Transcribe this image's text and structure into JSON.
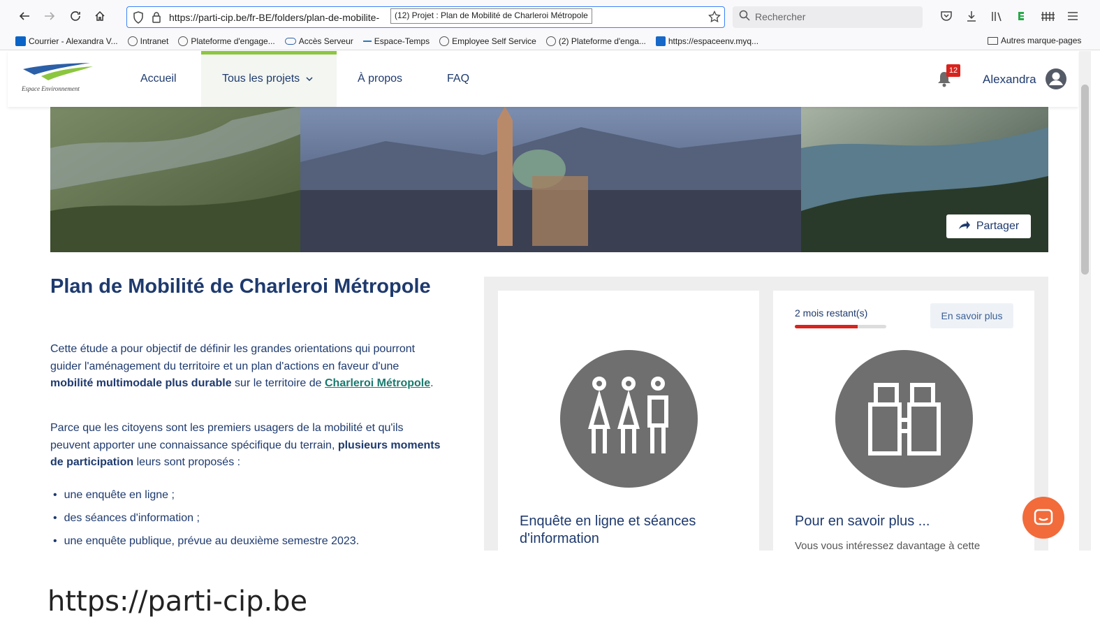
{
  "browser": {
    "url": "https://parti-cip.be/fr-BE/folders/plan-de-mobilite-",
    "tab_tooltip": "(12) Projet : Plan de Mobilité de Charleroi Métropole",
    "search_placeholder": "Rechercher",
    "bookmarks": [
      {
        "label": "Courrier - Alexandra V..."
      },
      {
        "label": "Intranet"
      },
      {
        "label": "Plateforme d'engage..."
      },
      {
        "label": "Accès Serveur"
      },
      {
        "label": "Espace-Temps"
      },
      {
        "label": "Employee Self Service"
      },
      {
        "label": "(2) Plateforme d'enga..."
      },
      {
        "label": "https://espaceenv.myq..."
      }
    ],
    "other_bookmarks": "Autres marque-pages"
  },
  "site": {
    "logo_text": "Espace Environnement",
    "nav": {
      "home": "Accueil",
      "projects": "Tous les projets",
      "about": "À propos",
      "faq": "FAQ"
    },
    "notifications_count": "12",
    "user_name": "Alexandra",
    "share_label": "Partager"
  },
  "project": {
    "title": "Plan de Mobilité de Charleroi Métropole",
    "p1_a": "Cette étude a pour objectif de définir les grandes orientations qui pourront guider l'aménagement du territoire et un plan d'actions en faveur d'une ",
    "p1_b": "mobilité multimodale plus durable",
    "p1_c": " sur le territoire de ",
    "p1_link": "Charleroi Métropole",
    "p1_d": ".",
    "p2_a": "Parce que les citoyens sont les premiers usagers de la mobilité et qu'ils peuvent apporter une connaissance spécifique du terrain, ",
    "p2_b": "plusieurs moments de participation",
    "p2_c": " leurs sont proposés :",
    "list": [
      "une enquête en ligne ;",
      "des séances d'information ;",
      "une enquête publique, prévue au deuxième semestre 2023."
    ]
  },
  "cards": [
    {
      "title": "Enquête en ligne et séances d'information",
      "icon": "people-icon"
    },
    {
      "title": "Pour en savoir plus ...",
      "subtitle": "Vous vous intéressez davantage à cette",
      "icon": "binoculars-icon",
      "remaining": "2 mois restant(s)",
      "progress": 0.69,
      "more_label": "En savoir plus"
    }
  ],
  "caption": "https://parti-cip.be",
  "colors": {
    "primary": "#1e3a6e",
    "accent_green": "#8cc63f",
    "progress_red": "#d9231d",
    "chat_orange": "#f26b3a"
  }
}
